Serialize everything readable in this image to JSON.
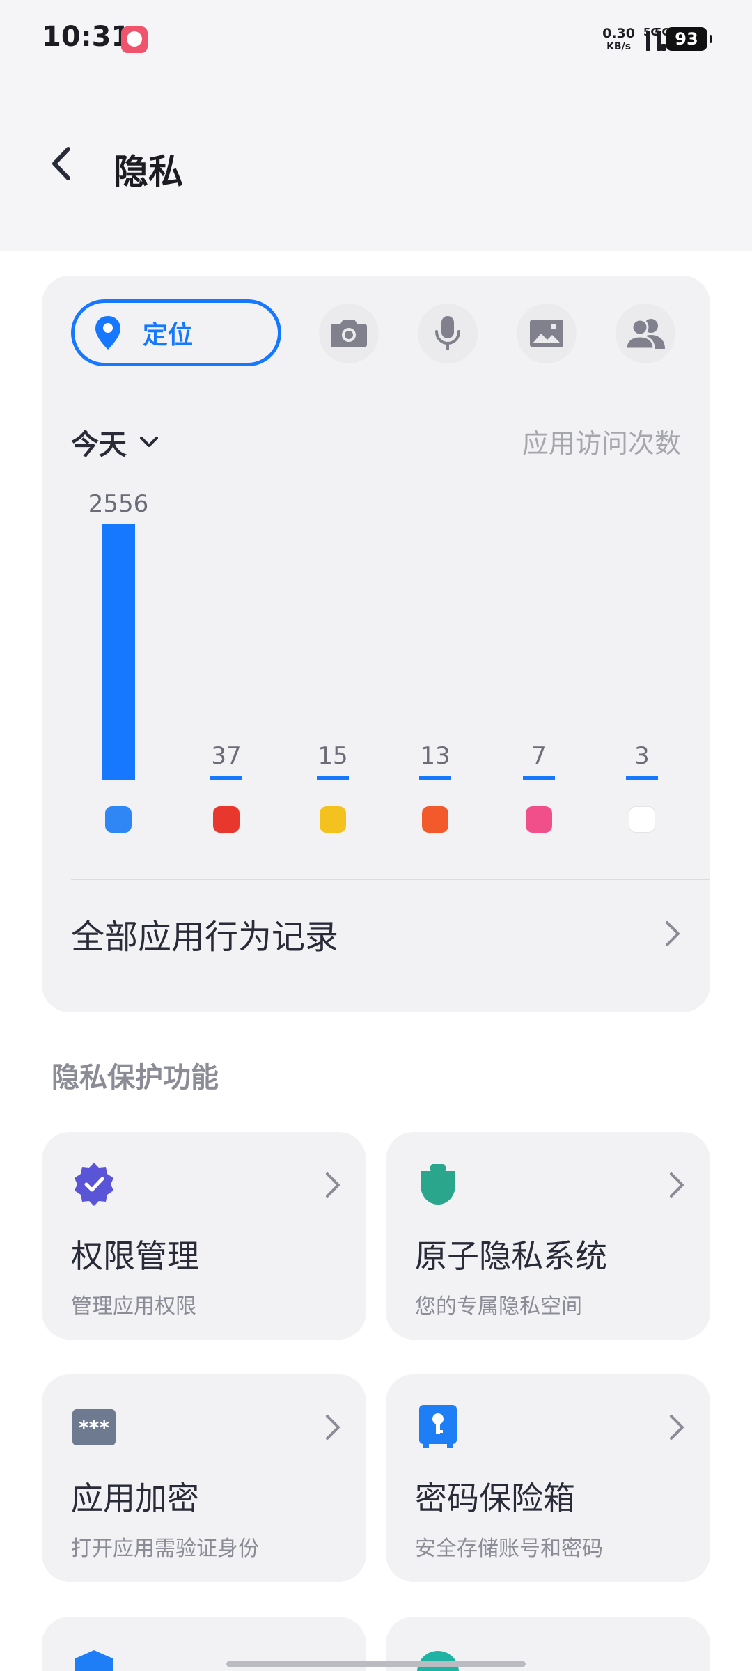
{
  "status_bar": {
    "time": "10:31",
    "net_speed_value": "0.30",
    "net_speed_unit": "KB/s",
    "signal1_label": "5G",
    "signal2_label": "5G",
    "battery": "93"
  },
  "header": {
    "title": "隐私"
  },
  "permission_tabs": [
    {
      "label": "定位",
      "icon": "location-pin-icon",
      "selected": true
    },
    {
      "icon": "camera-icon"
    },
    {
      "icon": "microphone-icon"
    },
    {
      "icon": "gallery-icon"
    },
    {
      "icon": "contacts-icon"
    }
  ],
  "usage": {
    "range_label": "今天",
    "metric_label": "应用访问次数",
    "records_label": "全部应用行为记录"
  },
  "chart_data": {
    "type": "bar",
    "values": [
      2556,
      37,
      15,
      13,
      7,
      3
    ],
    "value_labels": [
      "2556",
      "37",
      "15",
      "13",
      "7",
      "3"
    ],
    "app_icon_colors": [
      "#2f86f5",
      "#e8372d",
      "#f4c21f",
      "#f25a2b",
      "#f04f8a",
      "#ffffff"
    ],
    "bar_color": "#1677ff"
  },
  "section": {
    "title": "隐私保护功能"
  },
  "features": [
    {
      "title": "权限管理",
      "subtitle": "管理应用权限",
      "icon": "shield-check-icon"
    },
    {
      "title": "原子隐私系统",
      "subtitle": "您的专属隐私空间",
      "icon": "privacy-space-icon"
    },
    {
      "title": "应用加密",
      "subtitle": "打开应用需验证身份",
      "icon": "password-icon"
    },
    {
      "title": "密码保险箱",
      "subtitle": "安全存储账号和密码",
      "icon": "safe-box-icon"
    }
  ],
  "colors": {
    "accent": "#1677ff",
    "card_bg": "#f2f2f4",
    "purple": "#5a55d6",
    "teal": "#2aa68c"
  }
}
